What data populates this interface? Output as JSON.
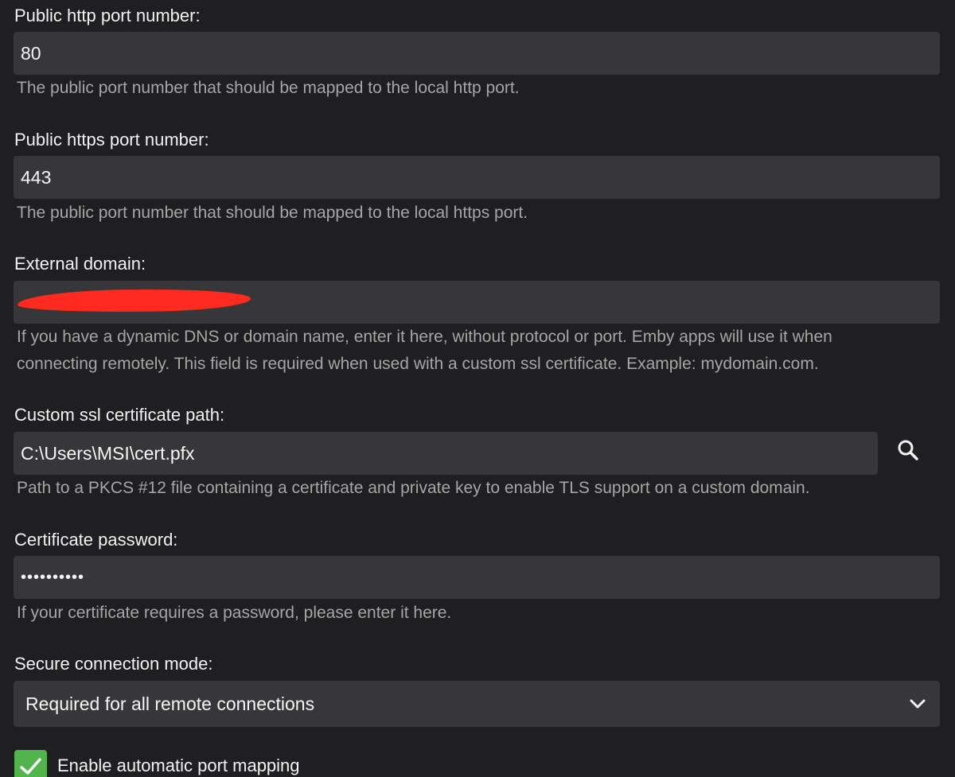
{
  "http_port": {
    "label": "Public http port number:",
    "value": "80",
    "help": "The public port number that should be mapped to the local http port."
  },
  "https_port": {
    "label": "Public https port number:",
    "value": "443",
    "help": "The public port number that should be mapped to the local https port."
  },
  "external_domain": {
    "label": "External domain:",
    "value": "",
    "help_line1": "If you have a dynamic DNS or domain name, enter it here, without protocol or port. Emby apps will use it when",
    "help_line2": "connecting remotely. This field is required when used with a custom ssl certificate. Example: mydomain.com."
  },
  "ssl_cert_path": {
    "label": "Custom ssl certificate path:",
    "value": "C:\\Users\\MSI\\cert.pfx",
    "help": "Path to a PKCS #12 file containing a certificate and private key to enable TLS support on a custom domain.",
    "browse_icon": "search-icon"
  },
  "cert_password": {
    "label": "Certificate password:",
    "value": "••••••••••",
    "help": "If your certificate requires a password, please enter it here."
  },
  "secure_mode": {
    "label": "Secure connection mode:",
    "selected": "Required for all remote connections",
    "icon": "chevron-down-icon"
  },
  "port_mapping": {
    "label": "Enable automatic port mapping",
    "checked": true,
    "icon": "checkmark-icon"
  },
  "colors": {
    "background": "#1f1e21",
    "field": "#373639",
    "help_text": "#a6a6a6",
    "accent": "#52b54b",
    "redaction": "#ff2a1f"
  }
}
